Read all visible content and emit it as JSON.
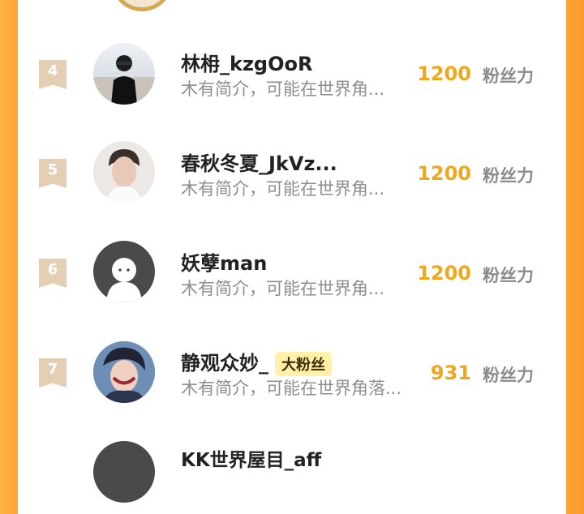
{
  "rows": [
    {
      "rank": "4",
      "name": "林枏_kzgOoR",
      "desc": "木有简介，可能在世界角...",
      "fans": "1200",
      "fans_label": "粉丝力",
      "badge": ""
    },
    {
      "rank": "5",
      "name": "春秋冬夏_JkVz...",
      "desc": "木有简介，可能在世界角...",
      "fans": "1200",
      "fans_label": "粉丝力",
      "badge": ""
    },
    {
      "rank": "6",
      "name": "妖孽man",
      "desc": "木有简介，可能在世界角...",
      "fans": "1200",
      "fans_label": "粉丝力",
      "badge": ""
    },
    {
      "rank": "7",
      "name": "静观众妙_",
      "desc": "木有简介，可能在世界角落...",
      "fans": "931",
      "fans_label": "粉丝力",
      "badge": "大粉丝"
    },
    {
      "rank": "",
      "name": "KK世界屋目_aff",
      "desc": "",
      "fans": "",
      "fans_label": "",
      "badge": ""
    }
  ],
  "colors": {
    "accent": "#f0a81b",
    "rank_bg": "#e5cfb4",
    "badge_bg": "#fff1a8"
  }
}
